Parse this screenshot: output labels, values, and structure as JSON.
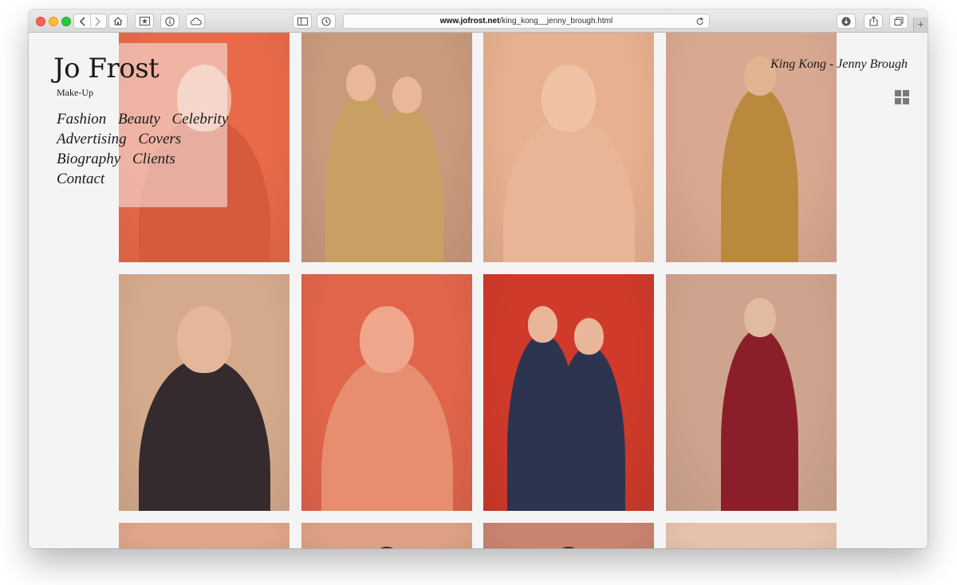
{
  "browser": {
    "url_domain": "www.jofrost.net",
    "url_path": "/king_kong__jenny_brough.html",
    "new_tab_label": "+"
  },
  "site": {
    "name": "Jo Frost",
    "tagline": "Make-Up",
    "nav": [
      {
        "label": "Fashion"
      },
      {
        "label": "Beauty"
      },
      {
        "label": "Celebrity"
      },
      {
        "label": "Advertising"
      },
      {
        "label": "Covers"
      },
      {
        "label": "Biography"
      },
      {
        "label": "Clients"
      },
      {
        "label": "Contact"
      }
    ],
    "page_caption": "King Kong - Jenny Brough"
  },
  "photos": [
    {
      "kind": "portrait",
      "bg": "#e86a48",
      "skin": "#f3b59e",
      "cloth": "#d65b3c"
    },
    {
      "kind": "duo",
      "bg": "#c99a7c",
      "skin": "#eab799",
      "cloth": "#c9a064"
    },
    {
      "kind": "portrait",
      "bg": "#e7b08f",
      "skin": "#f0c2a4",
      "cloth": "#e9b597"
    },
    {
      "kind": "seated",
      "bg": "#d9a891",
      "skin": "#e2b590",
      "cloth": "#b98a3e"
    },
    {
      "kind": "portrait",
      "bg": "#d5aa8c",
      "skin": "#e6b69a",
      "cloth": "#352a2e"
    },
    {
      "kind": "portrait",
      "bg": "#e0654b",
      "skin": "#f0a68c",
      "cloth": "#e68e6f"
    },
    {
      "kind": "duo",
      "bg": "#cf3a2a",
      "skin": "#eab69a",
      "cloth": "#2d3450"
    },
    {
      "kind": "seated",
      "bg": "#cfa48e",
      "skin": "#e1ba9f",
      "cloth": "#8a1f2a"
    },
    {
      "kind": "partial",
      "bg": "#e0a489",
      "skin": "#e4a98f",
      "cloth": "#d99a80"
    },
    {
      "kind": "partial",
      "bg": "#dda085",
      "skin": "#3a2a22",
      "cloth": "#d69b80"
    },
    {
      "kind": "partial",
      "bg": "#c9836e",
      "skin": "#3a2a22",
      "cloth": "#b9806a"
    },
    {
      "kind": "partial",
      "bg": "#e6c1ad",
      "skin": "#e9c4ad",
      "cloth": "#dcb7a2"
    }
  ],
  "colors": {
    "page_bg": "#f4f4f5",
    "text": "#1a1a1a",
    "close": "#fc5f57",
    "minimize": "#fdbd2e",
    "maximize": "#29c840"
  }
}
